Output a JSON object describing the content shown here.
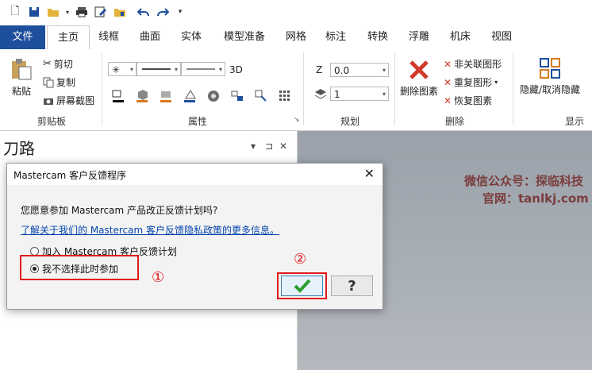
{
  "ribbon": {
    "tabs": [
      "文件",
      "主页",
      "线框",
      "曲面",
      "实体",
      "模型准备",
      "网格",
      "标注",
      "转换",
      "浮雕",
      "机床",
      "视图"
    ],
    "clipboard": {
      "paste": "粘贴",
      "cut": "剪切",
      "copy": "复制",
      "screenshot": "屏幕截图",
      "group": "剪贴板"
    },
    "properties": {
      "mode_3d": "3D",
      "group": "属性"
    },
    "planning": {
      "z_label": "Z",
      "z_value": "0.0",
      "level_value": "1",
      "group": "规划"
    },
    "delete": {
      "delete_entities": "删除图素",
      "unlink": "非关联图形",
      "duplicate": "重复图形",
      "restore": "恢复图素",
      "group": "删除"
    },
    "display": {
      "hide_unhide": "隐藏/取消隐藏",
      "group": "显示"
    }
  },
  "panel": {
    "title": "刀路",
    "pin": "⊐",
    "close": "✕",
    "dropdown": "▾"
  },
  "watermark": {
    "line1": "微信公众号：探临科技",
    "line2": "官网：tanlkj.com"
  },
  "dialog": {
    "title": "Mastercam 客户反馈程序",
    "question": "您愿意参加 Mastercam 产品改正反馈计划吗?",
    "link": "了解关于我们的 Mastercam 客户反馈隐私政策的更多信息。",
    "option_join": "加入 Mastercam 客户反馈计划",
    "option_decline": "我不选择此时参加",
    "ok_icon": "checkmark-icon",
    "help_icon": "help-icon"
  },
  "annotations": {
    "step1": "①",
    "step2": "②"
  },
  "colors": {
    "file_tab": "#1e4f9c",
    "highlight": "#e01a1a",
    "ok_check": "#2e9e2e"
  }
}
